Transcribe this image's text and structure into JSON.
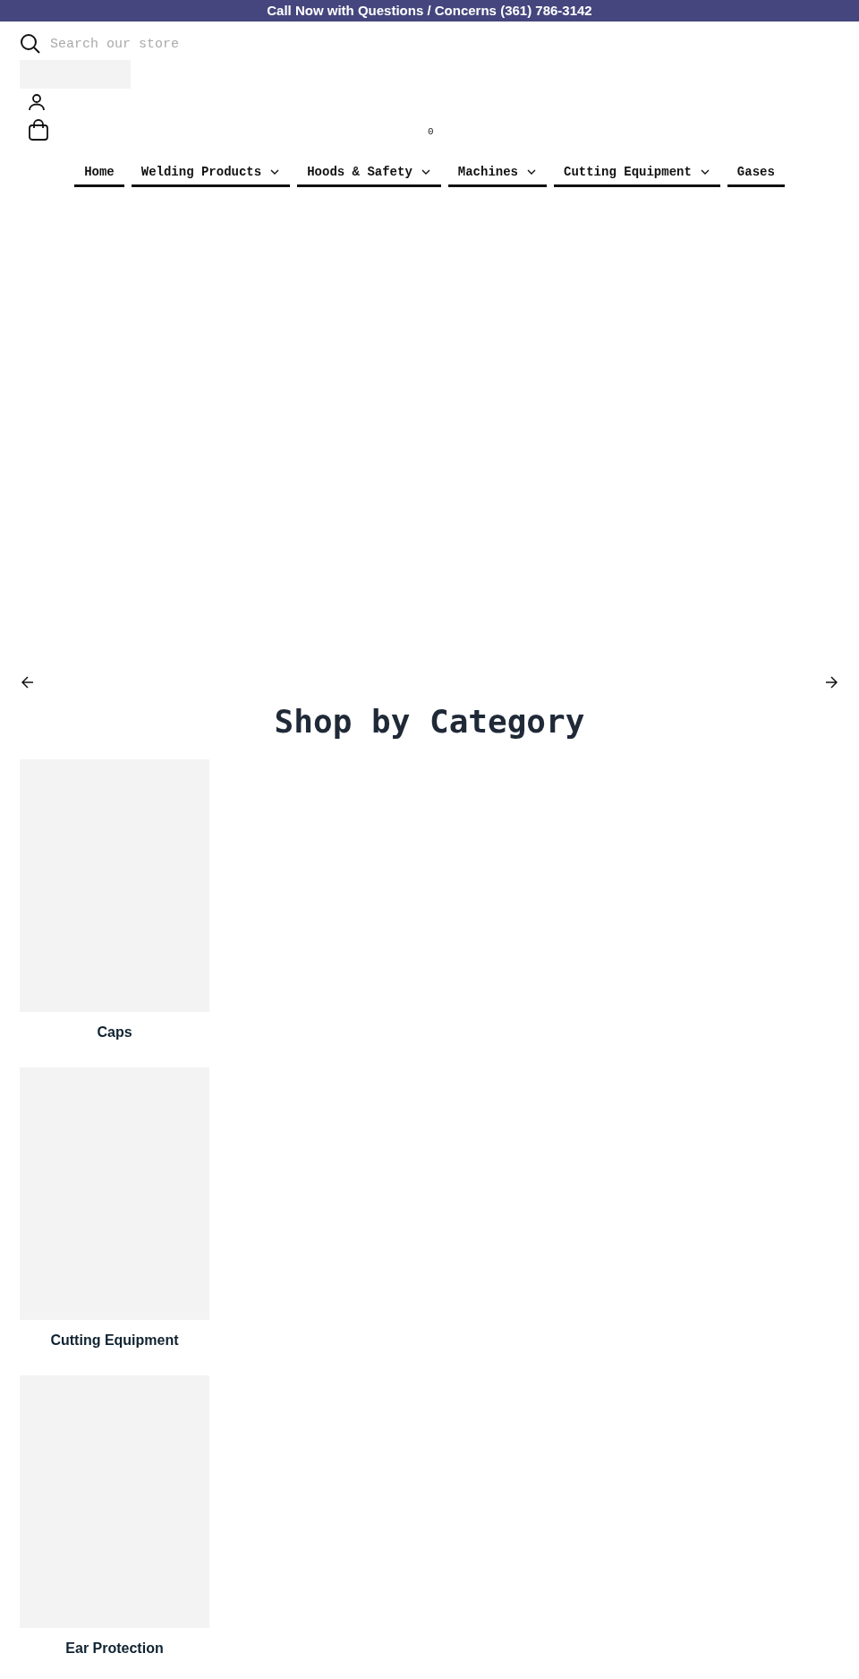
{
  "announcement": "Call Now with Questions / Concerns (361) 786-3142",
  "search": {
    "placeholder": "Search our store"
  },
  "cart": {
    "count": "0"
  },
  "nav": [
    {
      "label": "Home",
      "has_dropdown": false
    },
    {
      "label": "Welding Products",
      "has_dropdown": true
    },
    {
      "label": "Hoods & Safety",
      "has_dropdown": true
    },
    {
      "label": "Machines",
      "has_dropdown": true
    },
    {
      "label": "Cutting Equipment",
      "has_dropdown": true
    },
    {
      "label": "Gases",
      "has_dropdown": false
    }
  ],
  "section": {
    "title": "Shop by Category"
  },
  "categories": [
    {
      "name": "Caps"
    },
    {
      "name": "Cutting Equipment"
    },
    {
      "name": "Ear Protection"
    }
  ]
}
